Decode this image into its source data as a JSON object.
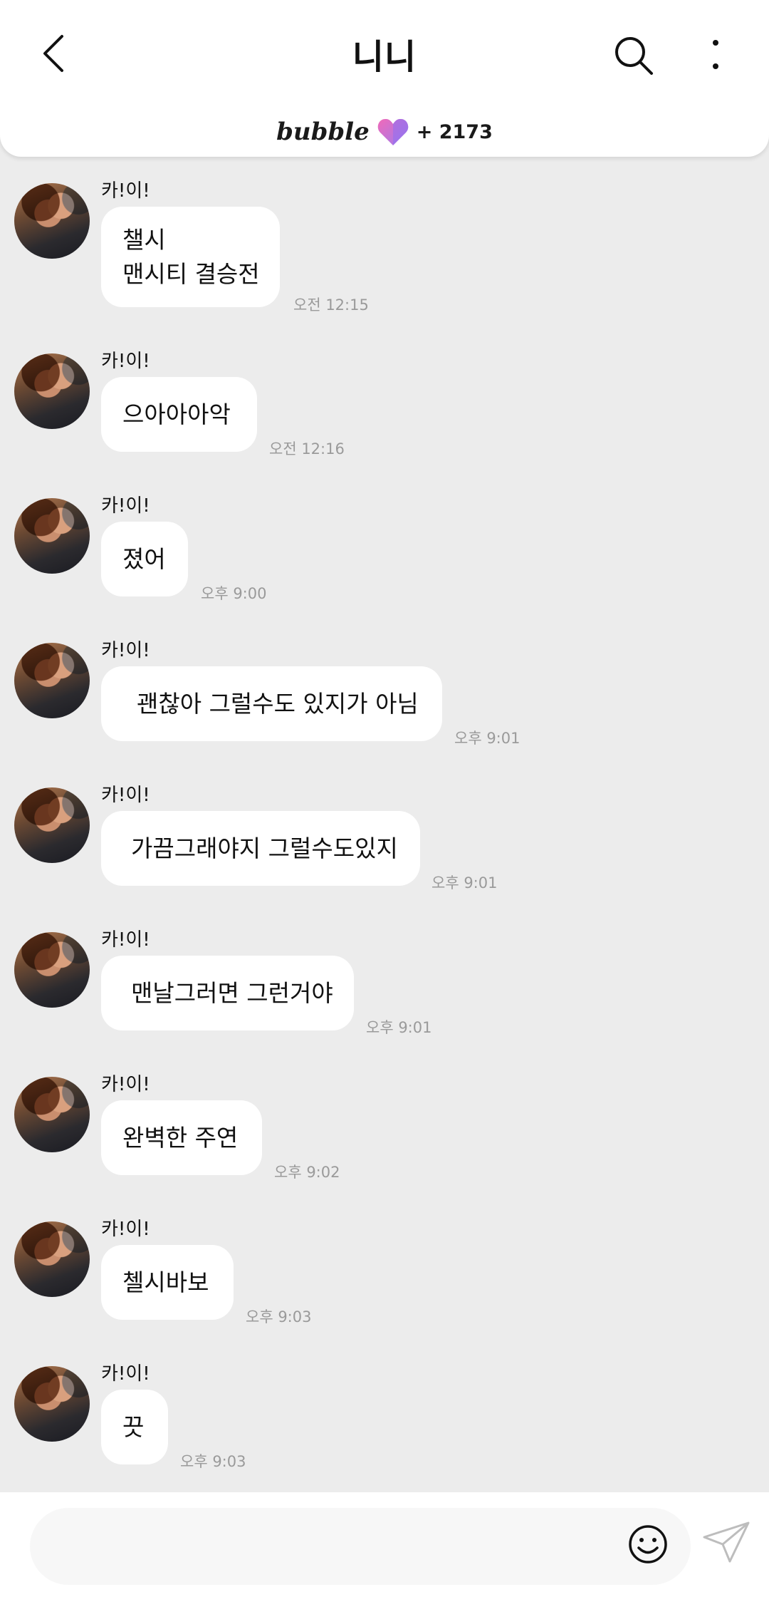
{
  "header": {
    "title": "니니",
    "brand": "bubble",
    "count": "+ 2173"
  },
  "messages": [
    {
      "sender": "카!이!",
      "text": "챌시\n맨시티 결승전",
      "time": "오전 12:15"
    },
    {
      "sender": "카!이!",
      "text": "으아아아악",
      "time": "오전 12:16"
    },
    {
      "sender": "카!이!",
      "text": "졌어",
      "time": "오후 9:00"
    },
    {
      "sender": "카!이!",
      "text": "괜찮아 그럴수도 있지가 아님",
      "time": "오후 9:01"
    },
    {
      "sender": "카!이!",
      "text": "가끔그래야지 그럴수도있지",
      "time": "오후 9:01"
    },
    {
      "sender": "카!이!",
      "text": "맨날그러면 그런거야",
      "time": "오후 9:01"
    },
    {
      "sender": "카!이!",
      "text": "완벽한 주연",
      "time": "오후 9:02"
    },
    {
      "sender": "카!이!",
      "text": "첼시바보",
      "time": "오후 9:03"
    },
    {
      "sender": "카!이!",
      "text": "끗",
      "time": "오후 9:03"
    }
  ],
  "composer": {
    "value": "",
    "placeholder": ""
  },
  "icons": {
    "back": "chevron-left-icon",
    "search": "search-icon",
    "more": "more-vertical-icon",
    "heart": "heart-icon",
    "emoji": "smiley-icon",
    "send": "paper-plane-icon"
  },
  "colors": {
    "background": "#ececec",
    "bubble": "#ffffff",
    "heart_pink": "#f06ab8",
    "heart_purple": "#9d7bf0"
  }
}
